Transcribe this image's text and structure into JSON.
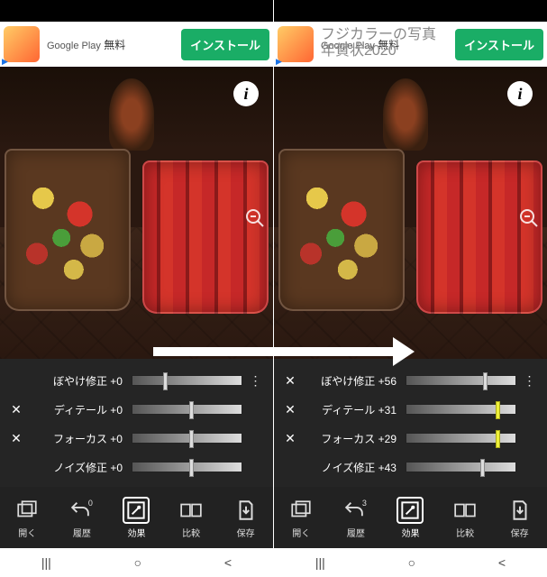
{
  "ad": {
    "store": "Google Play",
    "price": "無料",
    "install": "インストール",
    "overlay_line1": "フジカラーの写真",
    "overlay_line2": "年賀状2020"
  },
  "left": {
    "sliders": [
      {
        "label": "ぼやけ修正 +0",
        "pos": 28,
        "close": false,
        "yellow": false,
        "dots": false
      },
      {
        "label": "ディテール +0",
        "pos": 52,
        "close": true,
        "yellow": false,
        "dots": false
      },
      {
        "label": "フォーカス +0",
        "pos": 52,
        "close": true,
        "yellow": false,
        "dots": false
      },
      {
        "label": "ノイズ修正 +0",
        "pos": 52,
        "close": false,
        "yellow": false,
        "dots": false
      }
    ],
    "history_badge": "0"
  },
  "right": {
    "sliders": [
      {
        "label": "ぼやけ修正 +56",
        "pos": 70,
        "close": true,
        "yellow": false,
        "dots": true
      },
      {
        "label": "ディテール +31",
        "pos": 82,
        "close": true,
        "yellow": true,
        "dots": false
      },
      {
        "label": "フォーカス +29",
        "pos": 82,
        "close": true,
        "yellow": true,
        "dots": false
      },
      {
        "label": "ノイズ修正 +43",
        "pos": 68,
        "close": false,
        "yellow": false,
        "dots": false
      }
    ],
    "history_badge": "3"
  },
  "toolbar": {
    "open": "開く",
    "history": "履歴",
    "effect": "効果",
    "compare": "比較",
    "save": "保存"
  },
  "info_glyph": "i"
}
